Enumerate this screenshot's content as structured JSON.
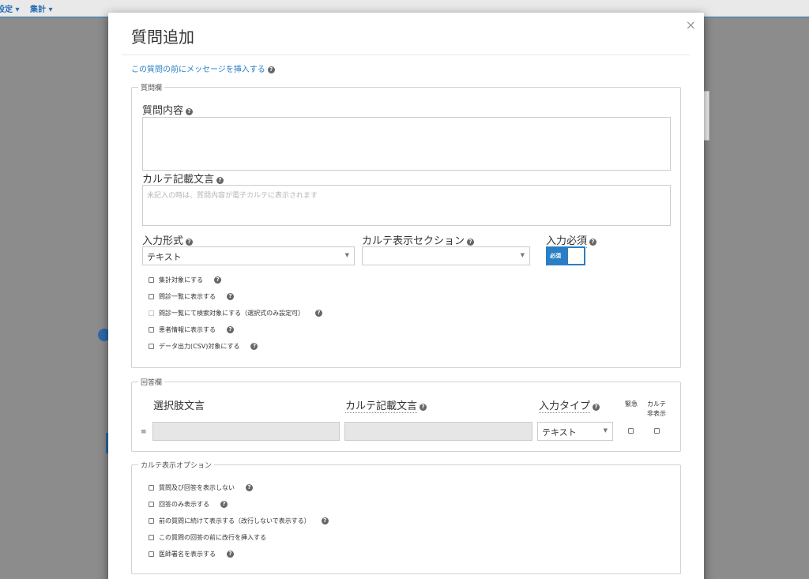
{
  "background_nav": {
    "item1": "設定 ▾",
    "item2": "集計 ▾"
  },
  "modal": {
    "title": "質問追加",
    "close_label": "×",
    "insert_link": "この質問の前にメッセージを挿入する",
    "help_icon": "?"
  },
  "question_section": {
    "legend": "質問欄",
    "content_label": "質問内容",
    "karte_text_label": "カルテ記載文言",
    "karte_text_placeholder": "未記入の時は、質問内容が電子カルテに表示されます",
    "input_format_label": "入力形式",
    "input_format_value": "テキスト",
    "karte_section_label": "カルテ表示セクション",
    "karte_section_value": "",
    "required_label": "入力必須",
    "required_toggle_text": "必須",
    "checkboxes": [
      "集計対象にする",
      "問診一覧に表示する",
      "問診一覧にて検索対象にする（選択式のみ設定可）",
      "患者情報に表示する",
      "データ出力(CSV)対象にする"
    ]
  },
  "answer_section": {
    "legend": "回答欄",
    "choice_text_header": "選択肢文言",
    "karte_text_header": "カルテ記載文言",
    "input_type_header": "入力タイプ",
    "urgent_header": "緊急",
    "karte_hide_header_line1": "カルテ",
    "karte_hide_header_line2": "非表示",
    "input_type_value": "テキスト",
    "drag_icon": "≡"
  },
  "karte_options_section": {
    "legend": "カルテ表示オプション",
    "checkboxes": [
      "質問及び回答を表示しない",
      "回答のみ表示する",
      "前の質問に続けて表示する（改行しないで表示する）",
      "この質問の回答の前に改行を挿入する",
      "医師署名を表示する"
    ]
  },
  "colors": {
    "accent": "#2a7fc4",
    "overlay": "#8c8c8c"
  }
}
